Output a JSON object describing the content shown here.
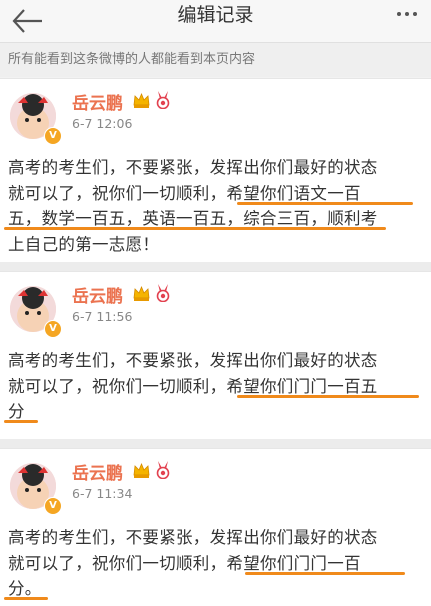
{
  "header": {
    "title": "编辑记录",
    "back_icon": "back-arrow-icon",
    "more_icon": "more-dots-icon"
  },
  "notice": "所有能看到这条微博的人都能看到本页内容",
  "colors": {
    "username": "#eb7350",
    "highlight_underline": "#f08a1b",
    "verified_badge": "#f5a623"
  },
  "posts": [
    {
      "username": "岳云鹏",
      "time": "6-7 12:06",
      "lines": [
        "高考的考生们，不要紧张，发挥出你们最好的状态",
        "就可以了，祝你们一切顺利，希望你们语文一百",
        "五，数学一百五，英语一百五，综合三百，顺利考",
        "上自己的第一志愿！"
      ]
    },
    {
      "username": "岳云鹏",
      "time": "6-7 11:56",
      "lines": [
        "高考的考生们，不要紧张，发挥出你们最好的状态",
        "就可以了，祝你们一切顺利，希望你们门门一百五",
        "分"
      ]
    },
    {
      "username": "岳云鹏",
      "time": "6-7 11:34",
      "lines": [
        "高考的考生们，不要紧张，发挥出你们最好的状态",
        "就可以了，祝你们一切顺利，希望你们门门一百",
        "分。"
      ]
    }
  ]
}
